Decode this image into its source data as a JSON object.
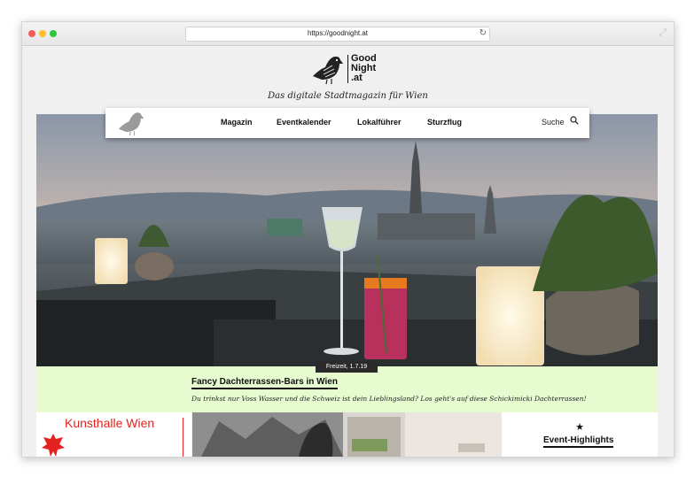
{
  "browser": {
    "url": "https://goodnight.at"
  },
  "site": {
    "logo_lines": [
      "Good",
      "Night",
      ".at"
    ],
    "tagline": "Das digitale Stadtmagazin für Wien"
  },
  "nav": {
    "items": [
      "Magazin",
      "Eventkalender",
      "Lokalführer",
      "Sturzflug"
    ],
    "search_label": "Suche"
  },
  "hero": {
    "badge": "Freizeit, 1.7.19",
    "title": "Fancy Dachterrassen-Bars in Wien",
    "text": "Du trinkst nur Voss Wasser und die Schweiz ist dein Lieblingsland? Los geht's auf diese Schickimicki Dachterrassen!"
  },
  "tiles": {
    "kunsthalle_label": "Kunsthalle Wien",
    "events_title": "Event-Highlights",
    "events_icon": "star-icon"
  },
  "colors": {
    "caption_bg": "#e6fbd0",
    "kunsthalle_red": "#e52220"
  }
}
